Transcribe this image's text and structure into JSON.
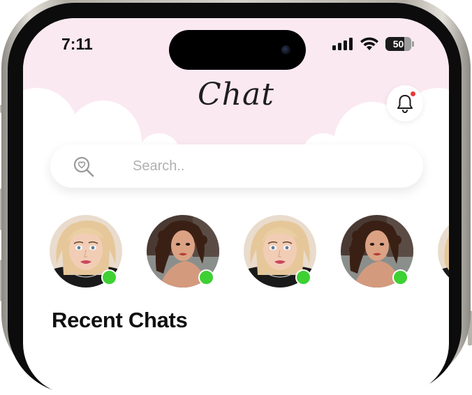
{
  "status_bar": {
    "time": "7:11",
    "battery_level": "50",
    "signal_icon": "cellular-signal-icon",
    "wifi_icon": "wifi-icon"
  },
  "header": {
    "title": "Chat",
    "notification_icon": "bell-icon",
    "has_unread_notification": true
  },
  "search": {
    "placeholder": "Search..",
    "icon": "search-heart-icon"
  },
  "stories": [
    {
      "avatar": "blonde-woman-avatar",
      "online": true
    },
    {
      "avatar": "curly-hair-woman-avatar",
      "online": true
    },
    {
      "avatar": "blonde-woman-avatar",
      "online": true
    },
    {
      "avatar": "curly-hair-woman-avatar",
      "online": true
    },
    {
      "avatar": "partial-avatar",
      "online": false
    }
  ],
  "recent_chats": {
    "title": "Recent Chats"
  },
  "colors": {
    "header_bg": "#fbe9f1",
    "online": "#3dd133",
    "notification_dot": "#e53935",
    "text_primary": "#101010",
    "placeholder": "#b0b0b0"
  }
}
